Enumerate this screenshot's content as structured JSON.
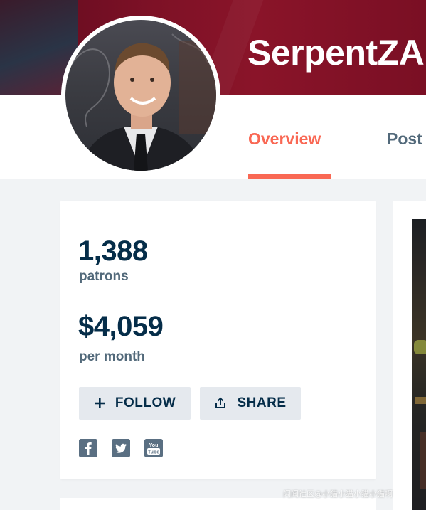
{
  "creator": {
    "name": "SerpentZA"
  },
  "tabs": [
    {
      "label": "Overview",
      "active": true
    },
    {
      "label": "Post",
      "active": false
    }
  ],
  "stats": {
    "patrons_value": "1,388",
    "patrons_label": "patrons",
    "earnings_value": "$4,059",
    "earnings_label": "per month"
  },
  "actions": {
    "follow_label": "FOLLOW",
    "share_label": "SHARE"
  },
  "social": [
    {
      "icon": "facebook-icon",
      "glyph": "f"
    },
    {
      "icon": "twitter-icon",
      "glyph": "t"
    },
    {
      "icon": "youtube-icon",
      "glyph": "You Tube"
    }
  ],
  "colors": {
    "banner": "#7d1126",
    "accent": "#f96854",
    "text_dark": "#052d49",
    "text_muted": "#52697a",
    "button_bg": "#e5e9ee"
  },
  "watermark": "闪闻社区@小猫小猫小猫小猫啊"
}
